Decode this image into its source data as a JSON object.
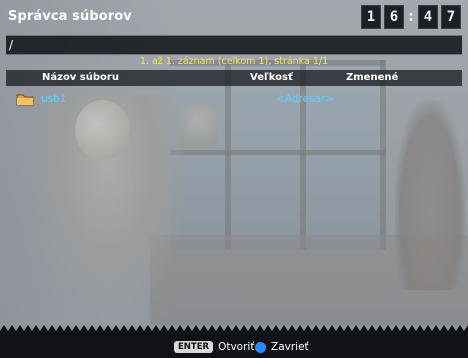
{
  "header": {
    "title": "Správca súborov",
    "clock": {
      "h1": "1",
      "h2": "6",
      "sep": ":",
      "m1": "4",
      "m2": "7"
    }
  },
  "path": "/",
  "records_info": "1. až 1. záznam (celkom 1), stránka 1/1",
  "columns": {
    "name": "Názov súboru",
    "size": "Veľkosť",
    "modified": "Zmenené"
  },
  "files": [
    {
      "name": "usb1",
      "size": "<Adresár>",
      "modified": "",
      "icon": "folder-icon"
    }
  ],
  "footer": {
    "enter_key": "ENTER",
    "open_label": "Otvoriť",
    "close_label": "Zavrieť",
    "close_key_color": "#2e8bff"
  },
  "colors": {
    "accent_text": "#5ad2ff",
    "info_text": "#f3e36a"
  }
}
